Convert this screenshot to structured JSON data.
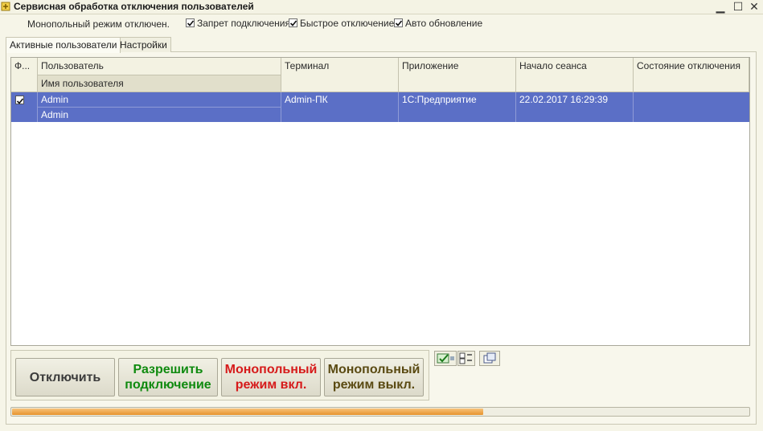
{
  "window": {
    "title": "Сервисная обработка отключения пользователей"
  },
  "options": {
    "monopoly_status": "Монопольный режим отключен.",
    "checkboxes": [
      {
        "label": "Запрет подключения",
        "checked": true
      },
      {
        "label": "Быстрое отключение",
        "checked": true
      },
      {
        "label": "Авто обновление",
        "checked": true
      }
    ]
  },
  "tabs": [
    {
      "label": "Активные пользователи",
      "active": true
    },
    {
      "label": "Настройки",
      "active": false
    }
  ],
  "table": {
    "columns": {
      "flag": "Ф...",
      "user": "Пользователь",
      "user_sub": "Имя пользователя",
      "terminal": "Терминал",
      "application": "Приложение",
      "session_start": "Начало сеанса",
      "disconnect_state": "Состояние отключения"
    },
    "rows": [
      {
        "checked": true,
        "user": "Admin",
        "user_name": "Admin",
        "terminal": "Admin-ПК",
        "application": "1С:Предприятие",
        "session_start": "22.02.2017 16:29:39",
        "disconnect_state": ""
      }
    ]
  },
  "buttons": {
    "disconnect": "Отключить",
    "allow_connection": "Разрешить подключение",
    "monopoly_on": "Монопольный режим вкл.",
    "monopoly_off": "Монопольный режим выкл."
  },
  "colors": {
    "selection": "#5b6fc6",
    "allow": "#0f8a0f",
    "monopoly_on": "#d61a1a",
    "monopoly_off": "#5a4a12",
    "progress": "#e6932e"
  },
  "progress": {
    "fraction": 0.64
  }
}
